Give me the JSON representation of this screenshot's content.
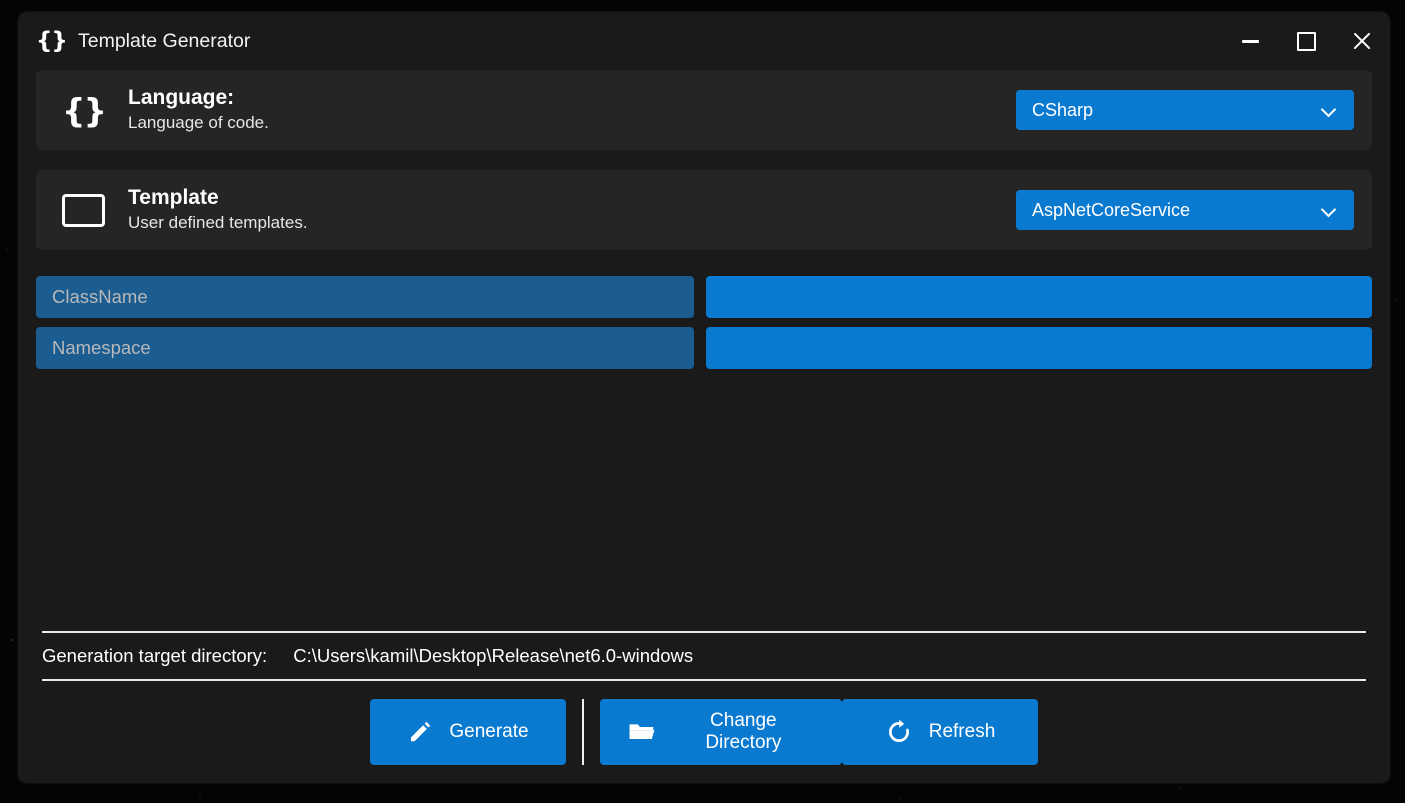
{
  "window": {
    "title": "Template Generator",
    "brand_icon": "braces-icon",
    "controls": {
      "minimize": "minimize-icon",
      "maximize": "maximize-icon",
      "close": "close-icon"
    }
  },
  "settings": [
    {
      "icon": "braces-icon",
      "title": "Language:",
      "subtitle": "Language of code.",
      "dropdown_value": "CSharp"
    },
    {
      "icon": "window-rectangle-icon",
      "title": "Template",
      "subtitle": "User defined templates.",
      "dropdown_value": "AspNetCoreService"
    }
  ],
  "fields": [
    {
      "key": "ClassName",
      "value": "",
      "placeholder": ""
    },
    {
      "key": "Namespace",
      "value": "",
      "placeholder": ""
    }
  ],
  "footer": {
    "target_label": "Generation target directory:",
    "target_path": "C:\\Users\\kamil\\Desktop\\Release\\net6.0-windows",
    "buttons": [
      {
        "label": "Generate",
        "icon": "pencil-icon"
      },
      {
        "label": "Change Directory",
        "icon": "folder-open-icon"
      },
      {
        "label": "Refresh",
        "icon": "refresh-icon"
      }
    ]
  },
  "colors": {
    "accent": "#0a7ad1",
    "field_key": "#1b5c91",
    "card_background": "#252525",
    "window_background": "#1b1b1b"
  }
}
